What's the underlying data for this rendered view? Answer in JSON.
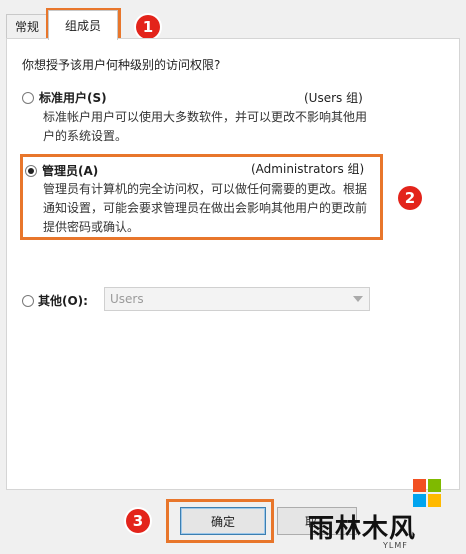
{
  "tabs": [
    {
      "label": "常规"
    },
    {
      "label": "组成员"
    }
  ],
  "question": "你想授予该用户何种级别的访问权限?",
  "options": {
    "standard": {
      "label": "标准用户(S)",
      "group": "(Users 组)",
      "desc_line1": "标准帐户用户可以使用大多数软件，并可以更改不影响其他用",
      "desc_line2": "户的系统设置。"
    },
    "admin": {
      "label": "管理员(A)",
      "group": "(Administrators 组)",
      "desc_line1": "管理员有计算机的完全访问权，可以做任何需要的更改。根据",
      "desc_line2": "通知设置，可能会要求管理员在做出会影响其他用户的更改前",
      "desc_line3": "提供密码或确认。"
    },
    "other": {
      "label": "其他(O):",
      "select_value": "Users"
    }
  },
  "buttons": {
    "ok": "确定",
    "cancel": "取"
  },
  "badges": [
    "1",
    "2",
    "3"
  ],
  "watermark": {
    "text": "雨林木风",
    "sub": "YLMF"
  },
  "colors": {
    "highlight": "#e8762b",
    "badge": "#e3241b"
  }
}
